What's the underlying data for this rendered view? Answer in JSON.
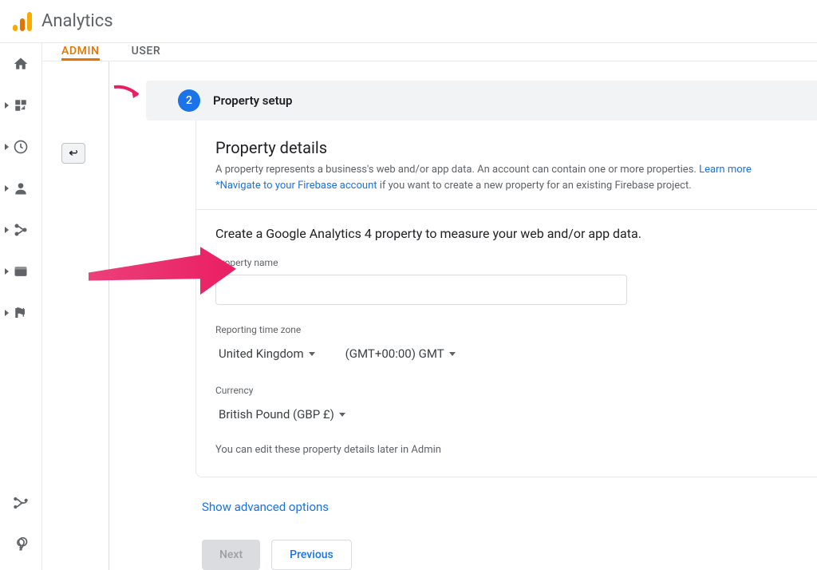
{
  "header": {
    "product": "Analytics"
  },
  "tabs": {
    "admin": "ADMIN",
    "user": "USER"
  },
  "step": {
    "number": "2",
    "title": "Property setup"
  },
  "details": {
    "heading": "Property details",
    "desc_part1": "A property represents a business's web and/or app data. An account can contain one or more properties. ",
    "learn_more": "Learn more",
    "firebase_link": "*Navigate to your Firebase account",
    "desc_part2": " if you want to create a new property for an existing Firebase project.",
    "subhead": "Create a Google Analytics 4 property to measure your web and/or app data.",
    "property_name_label": "Property name",
    "property_name_value": "",
    "tz_label": "Reporting time zone",
    "tz_country": "United Kingdom",
    "tz_value": "(GMT+00:00) GMT",
    "currency_label": "Currency",
    "currency_value": "British Pound (GBP £)",
    "note": "You can edit these property details later in Admin"
  },
  "advanced": "Show advanced options",
  "buttons": {
    "next": "Next",
    "previous": "Previous"
  }
}
